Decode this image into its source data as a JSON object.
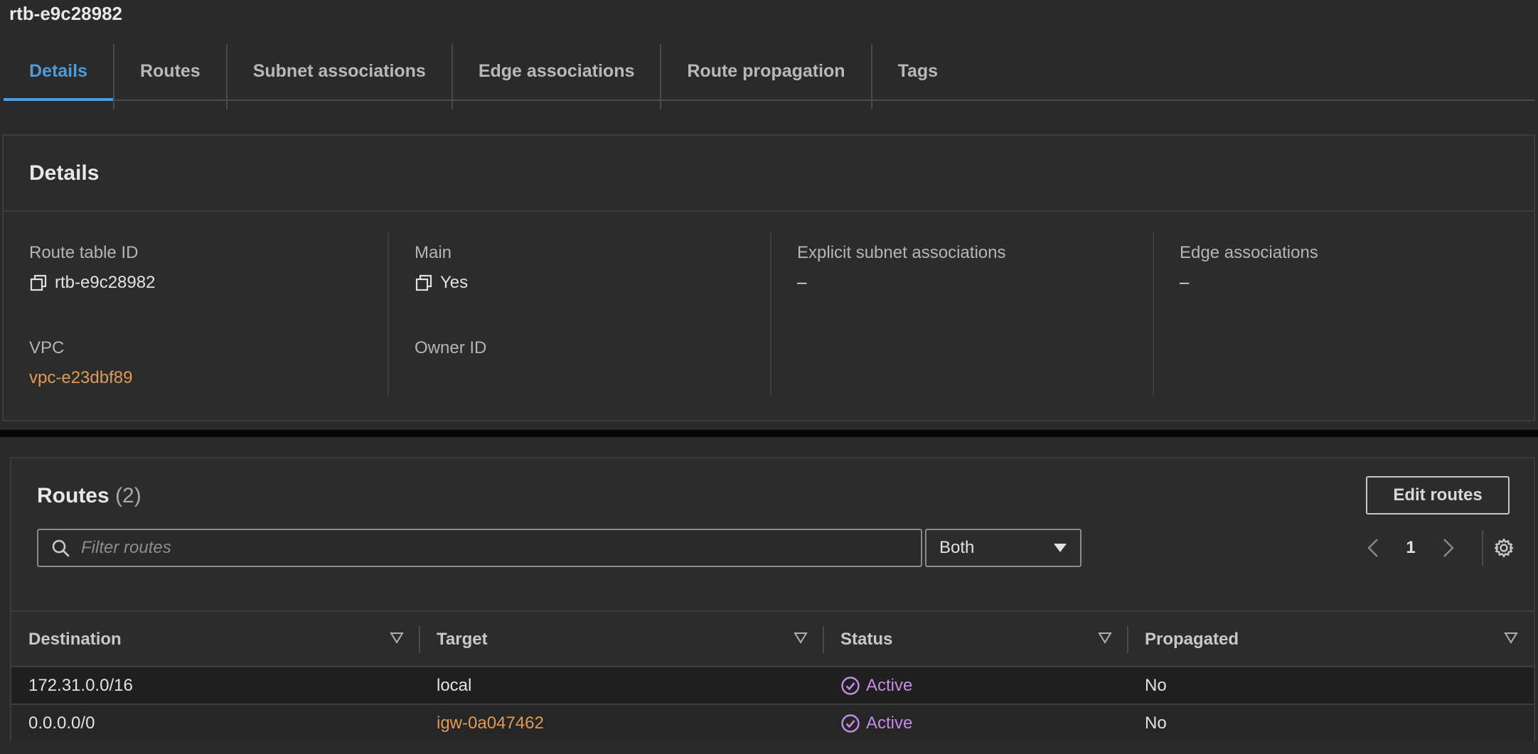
{
  "page": {
    "title": "rtb-e9c28982"
  },
  "tabs": [
    {
      "label": "Details",
      "active": true
    },
    {
      "label": "Routes",
      "active": false
    },
    {
      "label": "Subnet associations",
      "active": false
    },
    {
      "label": "Edge associations",
      "active": false
    },
    {
      "label": "Route propagation",
      "active": false
    },
    {
      "label": "Tags",
      "active": false
    }
  ],
  "details": {
    "title": "Details",
    "route_table_id": {
      "label": "Route table ID",
      "value": "rtb-e9c28982",
      "icon": "copy-icon"
    },
    "vpc": {
      "label": "VPC",
      "value": "vpc-e23dbf89"
    },
    "main": {
      "label": "Main",
      "value": "Yes",
      "icon": "copy-icon"
    },
    "owner_id": {
      "label": "Owner ID",
      "value": ""
    },
    "explicit_subnet": {
      "label": "Explicit subnet associations",
      "value": "–"
    },
    "edge": {
      "label": "Edge associations",
      "value": "–"
    }
  },
  "routes": {
    "title": "Routes",
    "count": "(2)",
    "edit_button": "Edit routes",
    "filter_placeholder": "Filter routes",
    "filter_value": "",
    "select_value": "Both",
    "page_number": "1",
    "columns": [
      "Destination",
      "Target",
      "Status",
      "Propagated"
    ],
    "rows": [
      {
        "destination": "172.31.0.0/16",
        "target": "local",
        "target_link": false,
        "status": "Active",
        "propagated": "No"
      },
      {
        "destination": "0.0.0.0/0",
        "target": "igw-0a047462",
        "target_link": true,
        "status": "Active",
        "propagated": "No"
      }
    ]
  },
  "colors": {
    "background": "#2a2a2a",
    "accent_blue": "#4f9bd9",
    "link_orange": "#e09a55",
    "status_purple": "#c58be6"
  }
}
